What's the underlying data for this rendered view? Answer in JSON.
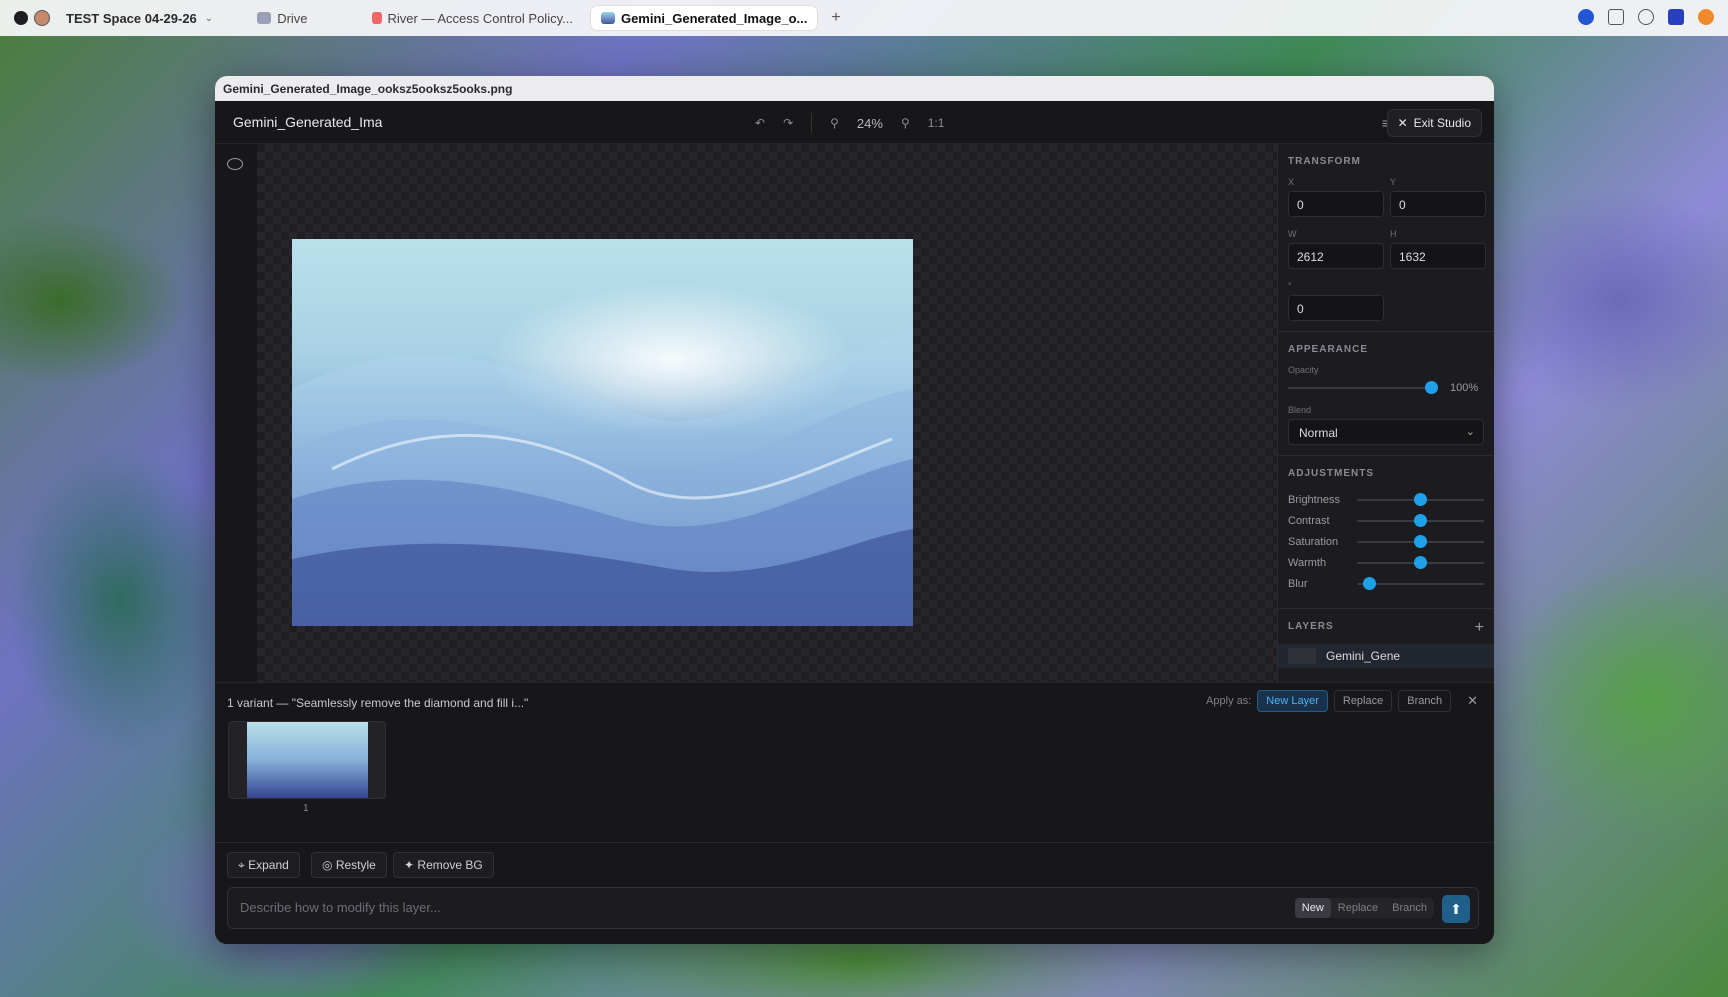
{
  "topbar": {
    "space_name": "TEST Space 04-29-26",
    "tabs": [
      {
        "label": "Drive"
      },
      {
        "label": "River — Access Control Policy..."
      },
      {
        "label": "Gemini_Generated_Image_o..."
      }
    ]
  },
  "window": {
    "file_title": "Gemini_Generated_Image_ooksz5ooksz5ooks.png"
  },
  "studio": {
    "title": "Gemini_Generated_Ima",
    "zoom": "24%",
    "ratio": "1:1",
    "exit_label": "Exit Studio"
  },
  "transform": {
    "title": "TRANSFORM",
    "x_label": "X",
    "x": "0",
    "y_label": "Y",
    "y": "0",
    "w_label": "W",
    "w": "2612",
    "h_label": "H",
    "h": "1632",
    "rotation_label": "°",
    "rotation": "0"
  },
  "appearance": {
    "title": "APPEARANCE",
    "opacity_label": "Opacity",
    "opacity_value": "100%",
    "opacity_level": 1.0,
    "blend_label": "Blend",
    "blend_value": "Normal"
  },
  "adjustments": {
    "title": "ADJUSTMENTS",
    "items": [
      {
        "label": "Brightness",
        "level": 0.5
      },
      {
        "label": "Contrast",
        "level": 0.5
      },
      {
        "label": "Saturation",
        "level": 0.5
      },
      {
        "label": "Warmth",
        "level": 0.5
      },
      {
        "label": "Blur",
        "level": 0.05
      }
    ]
  },
  "layers": {
    "title": "LAYERS",
    "item_label": "Gemini_Gene"
  },
  "variants": {
    "summary": "1 variant — \"Seamlessly remove the diamond and fill i...\"",
    "apply_as_label": "Apply as:",
    "options": [
      "New Layer",
      "Replace",
      "Branch"
    ],
    "thumb_number": "1"
  },
  "actions": {
    "expand": "Expand",
    "restyle": "Restyle",
    "remove_bg": "Remove BG",
    "prompt_placeholder": "Describe how to modify this layer...",
    "modes": [
      "New",
      "Replace",
      "Branch"
    ]
  },
  "colors": {
    "accent": "#1ea1e8"
  }
}
